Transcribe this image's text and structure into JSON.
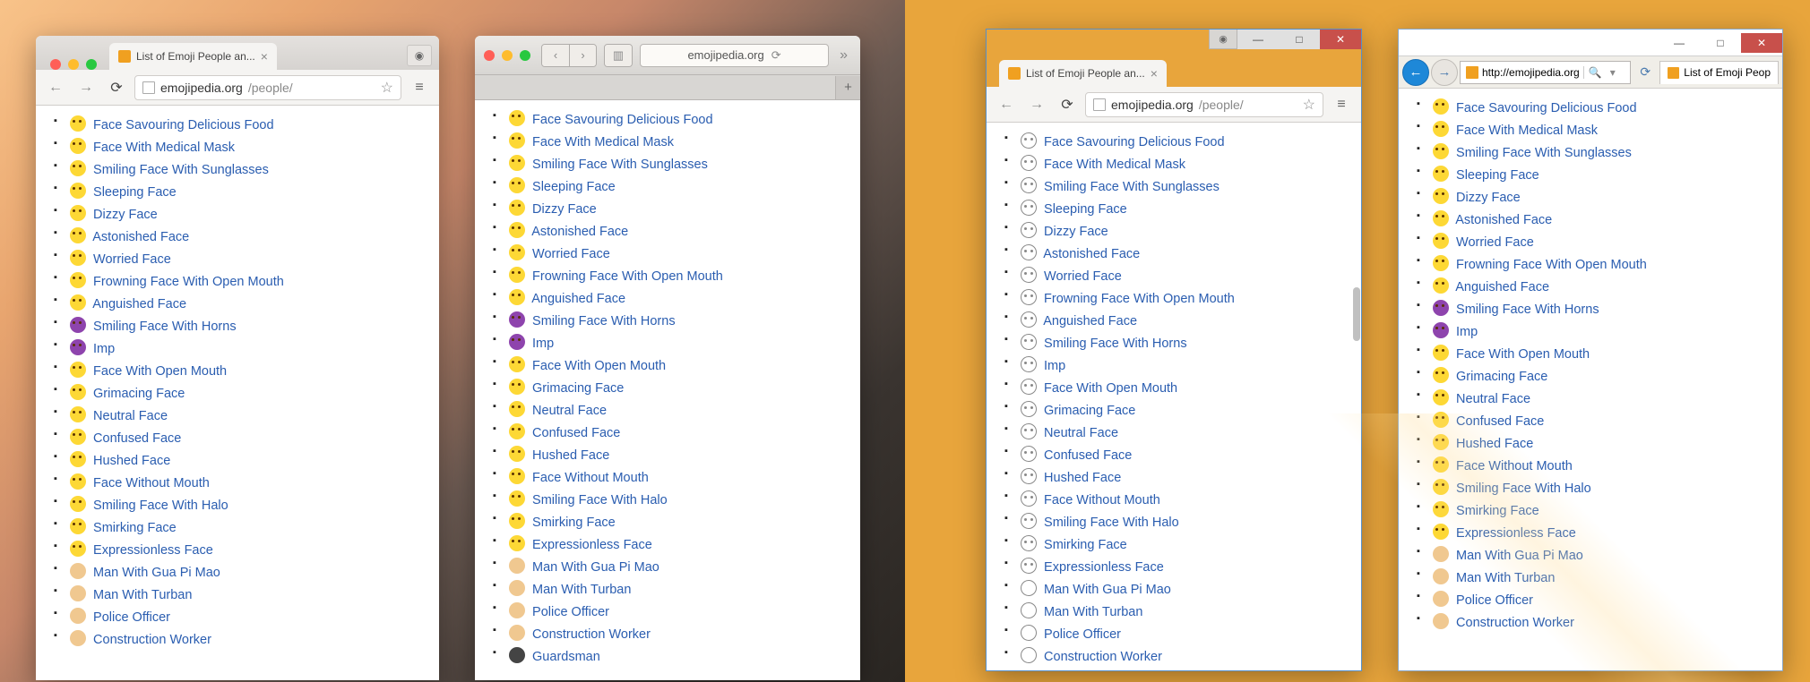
{
  "url_domain": "emojipedia.org",
  "url_path": "/people/",
  "ie_url": "http://emojipedia.org",
  "tab_title": "List of Emoji People an...",
  "ie_tab_title": "List of Emoji Peop",
  "emoji_list_short": [
    {
      "e": "😋",
      "cls": "",
      "t": "Face Savouring Delicious Food"
    },
    {
      "e": "😷",
      "cls": "",
      "t": "Face With Medical Mask"
    },
    {
      "e": "😎",
      "cls": "",
      "t": "Smiling Face With Sunglasses"
    },
    {
      "e": "😴",
      "cls": "",
      "t": "Sleeping Face"
    },
    {
      "e": "😵",
      "cls": "",
      "t": "Dizzy Face"
    },
    {
      "e": "😲",
      "cls": "",
      "t": "Astonished Face"
    },
    {
      "e": "😟",
      "cls": "",
      "t": "Worried Face"
    },
    {
      "e": "😦",
      "cls": "",
      "t": "Frowning Face With Open Mouth"
    },
    {
      "e": "😧",
      "cls": "",
      "t": "Anguished Face"
    },
    {
      "e": "😈",
      "cls": "horns",
      "t": "Smiling Face With Horns"
    },
    {
      "e": "👿",
      "cls": "imp",
      "t": "Imp"
    },
    {
      "e": "😮",
      "cls": "",
      "t": "Face With Open Mouth"
    },
    {
      "e": "😬",
      "cls": "",
      "t": "Grimacing Face"
    },
    {
      "e": "😐",
      "cls": "",
      "t": "Neutral Face"
    },
    {
      "e": "😕",
      "cls": "",
      "t": "Confused Face"
    },
    {
      "e": "😯",
      "cls": "",
      "t": "Hushed Face"
    },
    {
      "e": "😶",
      "cls": "",
      "t": "Face Without Mouth"
    },
    {
      "e": "😇",
      "cls": "",
      "t": "Smiling Face With Halo"
    },
    {
      "e": "😏",
      "cls": "",
      "t": "Smirking Face"
    },
    {
      "e": "😑",
      "cls": "",
      "t": "Expressionless Face"
    },
    {
      "e": "👲",
      "cls": "person",
      "t": "Man With Gua Pi Mao"
    },
    {
      "e": "👳",
      "cls": "person",
      "t": "Man With Turban"
    },
    {
      "e": "👮",
      "cls": "person",
      "t": "Police Officer"
    },
    {
      "e": "👷",
      "cls": "person",
      "t": "Construction Worker"
    }
  ],
  "emoji_list_long": [
    {
      "e": "😋",
      "cls": "",
      "t": "Face Savouring Delicious Food"
    },
    {
      "e": "😷",
      "cls": "",
      "t": "Face With Medical Mask"
    },
    {
      "e": "😎",
      "cls": "",
      "t": "Smiling Face With Sunglasses"
    },
    {
      "e": "😴",
      "cls": "",
      "t": "Sleeping Face"
    },
    {
      "e": "😵",
      "cls": "",
      "t": "Dizzy Face"
    },
    {
      "e": "😲",
      "cls": "",
      "t": "Astonished Face"
    },
    {
      "e": "😟",
      "cls": "",
      "t": "Worried Face"
    },
    {
      "e": "😦",
      "cls": "",
      "t": "Frowning Face With Open Mouth"
    },
    {
      "e": "😧",
      "cls": "",
      "t": "Anguished Face"
    },
    {
      "e": "😈",
      "cls": "horns",
      "t": "Smiling Face With Horns"
    },
    {
      "e": "👿",
      "cls": "imp",
      "t": "Imp"
    },
    {
      "e": "😮",
      "cls": "",
      "t": "Face With Open Mouth"
    },
    {
      "e": "😬",
      "cls": "",
      "t": "Grimacing Face"
    },
    {
      "e": "😐",
      "cls": "",
      "t": "Neutral Face"
    },
    {
      "e": "😕",
      "cls": "",
      "t": "Confused Face"
    },
    {
      "e": "😯",
      "cls": "",
      "t": "Hushed Face"
    },
    {
      "e": "😶",
      "cls": "",
      "t": "Face Without Mouth"
    },
    {
      "e": "😇",
      "cls": "",
      "t": "Smiling Face With Halo"
    },
    {
      "e": "😏",
      "cls": "",
      "t": "Smirking Face"
    },
    {
      "e": "😑",
      "cls": "",
      "t": "Expressionless Face"
    },
    {
      "e": "👲",
      "cls": "person",
      "t": "Man With Gua Pi Mao"
    },
    {
      "e": "👳",
      "cls": "person",
      "t": "Man With Turban"
    },
    {
      "e": "👮",
      "cls": "person",
      "t": "Police Officer"
    },
    {
      "e": "👷",
      "cls": "person",
      "t": "Construction Worker"
    },
    {
      "e": "💂",
      "cls": "guard",
      "t": "Guardsman"
    }
  ]
}
